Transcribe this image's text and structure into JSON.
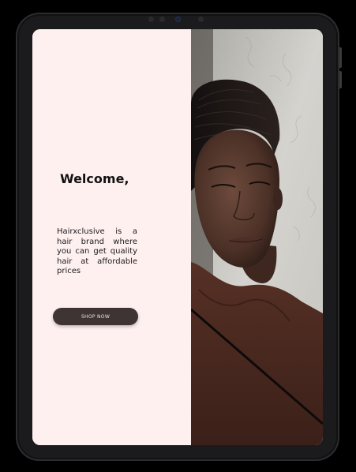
{
  "hero": {
    "heading": "Welcome,",
    "tagline": "Hairxclusive is a hair brand where you can get quality hair at affordable prices",
    "cta_label": "SHOP NOW"
  },
  "colors": {
    "page_background": "#000000",
    "device_frame": "#1b1b1d",
    "left_panel_bg": "#fff0f0",
    "cta_bg": "#3f3434",
    "cta_text": "#e9e3e3",
    "coat": "#4a2b22",
    "wall": "#cfcdc8"
  },
  "icons": {
    "camera": "camera-icon",
    "photo": "woman-portrait-image"
  }
}
